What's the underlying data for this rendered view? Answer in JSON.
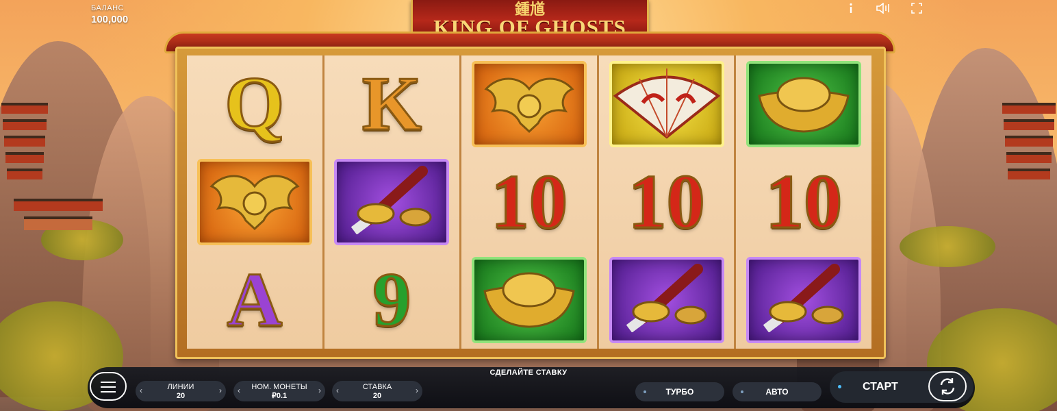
{
  "game": {
    "title_cn": "鍾馗",
    "title_en": "KING OF GHOSTS"
  },
  "balance": {
    "label": "БАЛАНС",
    "value": "100,000"
  },
  "top_icons": [
    "info-icon",
    "sound-icon",
    "fullscreen-icon"
  ],
  "reels": [
    [
      {
        "type": "letter",
        "text": "Q",
        "color": "#e6c21c"
      },
      {
        "type": "tile",
        "name": "golden-bat-symbol",
        "bg": "orange"
      },
      {
        "type": "letter",
        "text": "A",
        "color": "#9a43d3"
      }
    ],
    [
      {
        "type": "letter",
        "text": "K",
        "color": "#e8962a"
      },
      {
        "type": "tile",
        "name": "sword-symbol",
        "bg": "purple"
      },
      {
        "type": "letter",
        "text": "9",
        "color": "#27a02d"
      }
    ],
    [
      {
        "type": "tile",
        "name": "golden-bat-symbol",
        "bg": "orange"
      },
      {
        "type": "letter",
        "text": "10",
        "color": "#d42718"
      },
      {
        "type": "tile",
        "name": "gold-ingot-symbol",
        "bg": "green"
      }
    ],
    [
      {
        "type": "tile",
        "name": "fan-symbol",
        "bg": "yellow"
      },
      {
        "type": "letter",
        "text": "10",
        "color": "#d42718"
      },
      {
        "type": "tile",
        "name": "sword-symbol",
        "bg": "purple"
      }
    ],
    [
      {
        "type": "tile",
        "name": "gold-ingot-symbol",
        "bg": "green"
      },
      {
        "type": "letter",
        "text": "10",
        "color": "#d42718"
      },
      {
        "type": "tile",
        "name": "sword-symbol",
        "bg": "purple"
      }
    ]
  ],
  "controls": {
    "message": "СДЕЛАЙТЕ СТАВКУ",
    "lines": {
      "label": "ЛИНИИ",
      "value": "20"
    },
    "coin": {
      "label": "НОМ. МОНЕТЫ",
      "value": "₽0.1"
    },
    "bet": {
      "label": "СТАВКА",
      "value": "20"
    },
    "turbo_label": "ТУРБО",
    "auto_label": "АВТО",
    "start_label": "СТАРТ"
  }
}
